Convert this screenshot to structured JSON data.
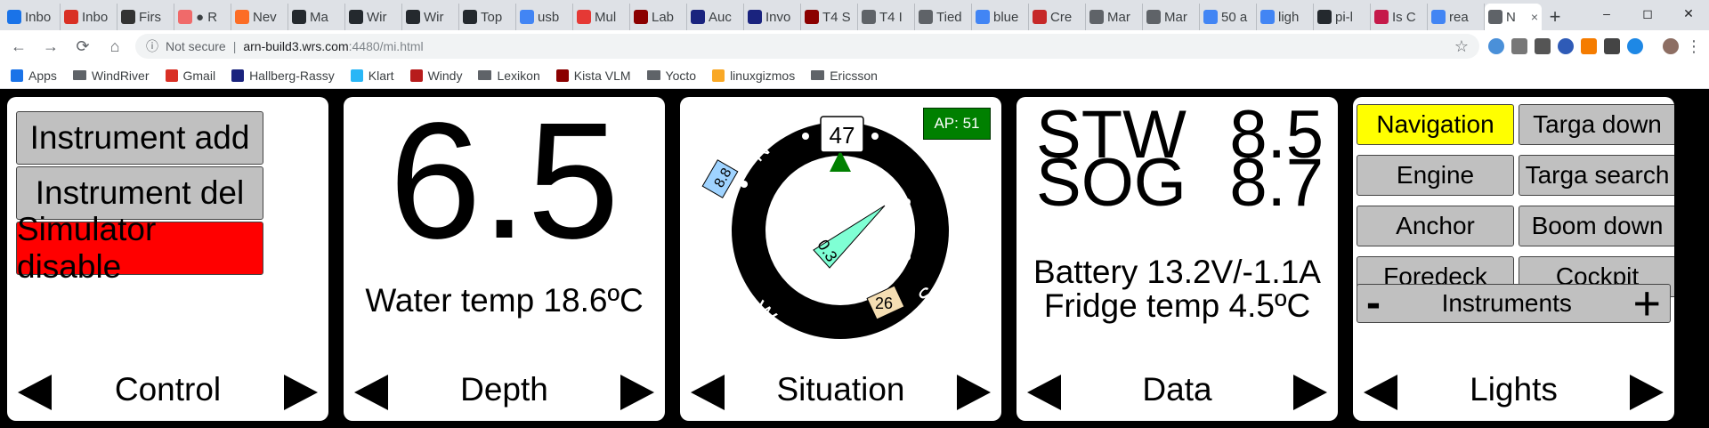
{
  "browser": {
    "tabs": [
      {
        "label": "Inbo",
        "icon": "mail-icon",
        "color": "#1a73e8"
      },
      {
        "label": "Inbo",
        "icon": "gmail-icon",
        "color": "#d93025"
      },
      {
        "label": "Firs",
        "icon": "badge-icon",
        "color": "#333333"
      },
      {
        "label": "● R",
        "icon": "asana-icon",
        "color": "#f06a6a"
      },
      {
        "label": "Nev",
        "icon": "gitlab-icon",
        "color": "#fc6d26"
      },
      {
        "label": "Ma",
        "icon": "github-icon",
        "color": "#24292e"
      },
      {
        "label": "Wir",
        "icon": "github-icon",
        "color": "#24292e"
      },
      {
        "label": "Wir",
        "icon": "github-icon",
        "color": "#24292e"
      },
      {
        "label": "Top",
        "icon": "github-icon",
        "color": "#24292e"
      },
      {
        "label": "usb",
        "icon": "google-icon",
        "color": "#4285f4"
      },
      {
        "label": "Mul",
        "icon": "plane-icon",
        "color": "#e53935"
      },
      {
        "label": "Lab",
        "icon": "u-icon",
        "color": "#8b0000"
      },
      {
        "label": "Auc",
        "icon": "building-icon",
        "color": "#1a237e"
      },
      {
        "label": "Invo",
        "icon": "building-icon",
        "color": "#1a237e"
      },
      {
        "label": "T4 S",
        "icon": "u-icon",
        "color": "#8b0000"
      },
      {
        "label": "T4 I",
        "icon": "doc-icon",
        "color": "#5f6368"
      },
      {
        "label": "Tied",
        "icon": "doc-icon",
        "color": "#5f6368"
      },
      {
        "label": "blue",
        "icon": "google-icon",
        "color": "#4285f4"
      },
      {
        "label": "Cre",
        "icon": "w-icon",
        "color": "#c62828"
      },
      {
        "label": "Mar",
        "icon": "doc-icon",
        "color": "#5f6368"
      },
      {
        "label": "Mar",
        "icon": "doc-icon",
        "color": "#5f6368"
      },
      {
        "label": "50 a",
        "icon": "google-icon",
        "color": "#4285f4"
      },
      {
        "label": "ligh",
        "icon": "google-icon",
        "color": "#4285f4"
      },
      {
        "label": "pi-l",
        "icon": "github-icon",
        "color": "#24292e"
      },
      {
        "label": "Is C",
        "icon": "pi-icon",
        "color": "#c51a4a"
      },
      {
        "label": "rea",
        "icon": "google-icon",
        "color": "#4285f4"
      },
      {
        "label": "N",
        "icon": "doc-icon",
        "color": "#5f6368",
        "active": true,
        "close": "×"
      }
    ],
    "new_tab": "+",
    "window_controls": {
      "minimize": "–",
      "maximize": "◻",
      "close": "✕"
    },
    "nav": {
      "back": "←",
      "forward": "→",
      "reload": "⟳",
      "home": "⌂"
    },
    "address": {
      "security": "Not secure",
      "separator": "|",
      "host": "arn-build3.wrs.com",
      "rest": ":4480/mi.html",
      "info_icon": "ⓘ",
      "star": "☆"
    },
    "bookmarks": [
      {
        "label": "Apps",
        "icon": "apps-icon",
        "color": "#1a73e8"
      },
      {
        "label": "WindRiver",
        "icon": "folder-icon",
        "color": "#5f6368"
      },
      {
        "label": "Gmail",
        "icon": "gmail-icon",
        "color": "#d93025"
      },
      {
        "label": "Hallberg-Rassy",
        "icon": "hr-icon",
        "color": "#1a237e"
      },
      {
        "label": "Klart",
        "icon": "cloud-icon",
        "color": "#29b6f6"
      },
      {
        "label": "Windy",
        "icon": "windy-icon",
        "color": "#b71c1c"
      },
      {
        "label": "Lexikon",
        "icon": "folder-icon",
        "color": "#5f6368"
      },
      {
        "label": "Kista VLM",
        "icon": "flag-icon",
        "color": "#8b0000"
      },
      {
        "label": "Yocto",
        "icon": "folder-icon",
        "color": "#5f6368"
      },
      {
        "label": "linuxgizmos",
        "icon": "gizmo-icon",
        "color": "#f9a825"
      },
      {
        "label": "Ericsson",
        "icon": "folder-icon",
        "color": "#5f6368"
      }
    ]
  },
  "panels": {
    "control": {
      "title": "Control",
      "buttons": [
        {
          "label": "Instrument add",
          "color": "#c0c0c0"
        },
        {
          "label": "Instrument del",
          "color": "#c0c0c0"
        },
        {
          "label": "Simulator disable",
          "color": "#ff0000"
        }
      ]
    },
    "depth": {
      "title": "Depth",
      "value": "6.5",
      "water_temp": "Water temp 18.6ºC"
    },
    "situation": {
      "title": "Situation",
      "heading": "47",
      "autopilot": "AP: 51",
      "autopilot_color": "#008000",
      "wind_speed": "0.3",
      "left_marker": "8.8",
      "right_marker": "26",
      "cardinals": {
        "north": "N",
        "east": "E",
        "south": "S",
        "west": "W"
      }
    },
    "data": {
      "title": "Data",
      "stw_label": "STW",
      "stw_value": "8.5",
      "sog_label": "SOG",
      "sog_value": "8.7",
      "battery": "Battery 13.2V/-1.1A",
      "fridge": "Fridge temp 4.5ºC"
    },
    "lights": {
      "title": "Lights",
      "buttons": [
        {
          "label": "Navigation",
          "color": "#ffff00"
        },
        {
          "label": "Targa down",
          "color": "#c0c0c0"
        },
        {
          "label": "Engine",
          "color": "#c0c0c0"
        },
        {
          "label": "Targa search",
          "color": "#c0c0c0"
        },
        {
          "label": "Anchor",
          "color": "#c0c0c0"
        },
        {
          "label": "Boom down",
          "color": "#c0c0c0"
        },
        {
          "label": "Foredeck",
          "color": "#c0c0c0"
        },
        {
          "label": "Cockpit",
          "color": "#c0c0c0"
        }
      ],
      "instruments": {
        "minus": "-",
        "label": "Instruments",
        "plus": "+"
      }
    }
  }
}
